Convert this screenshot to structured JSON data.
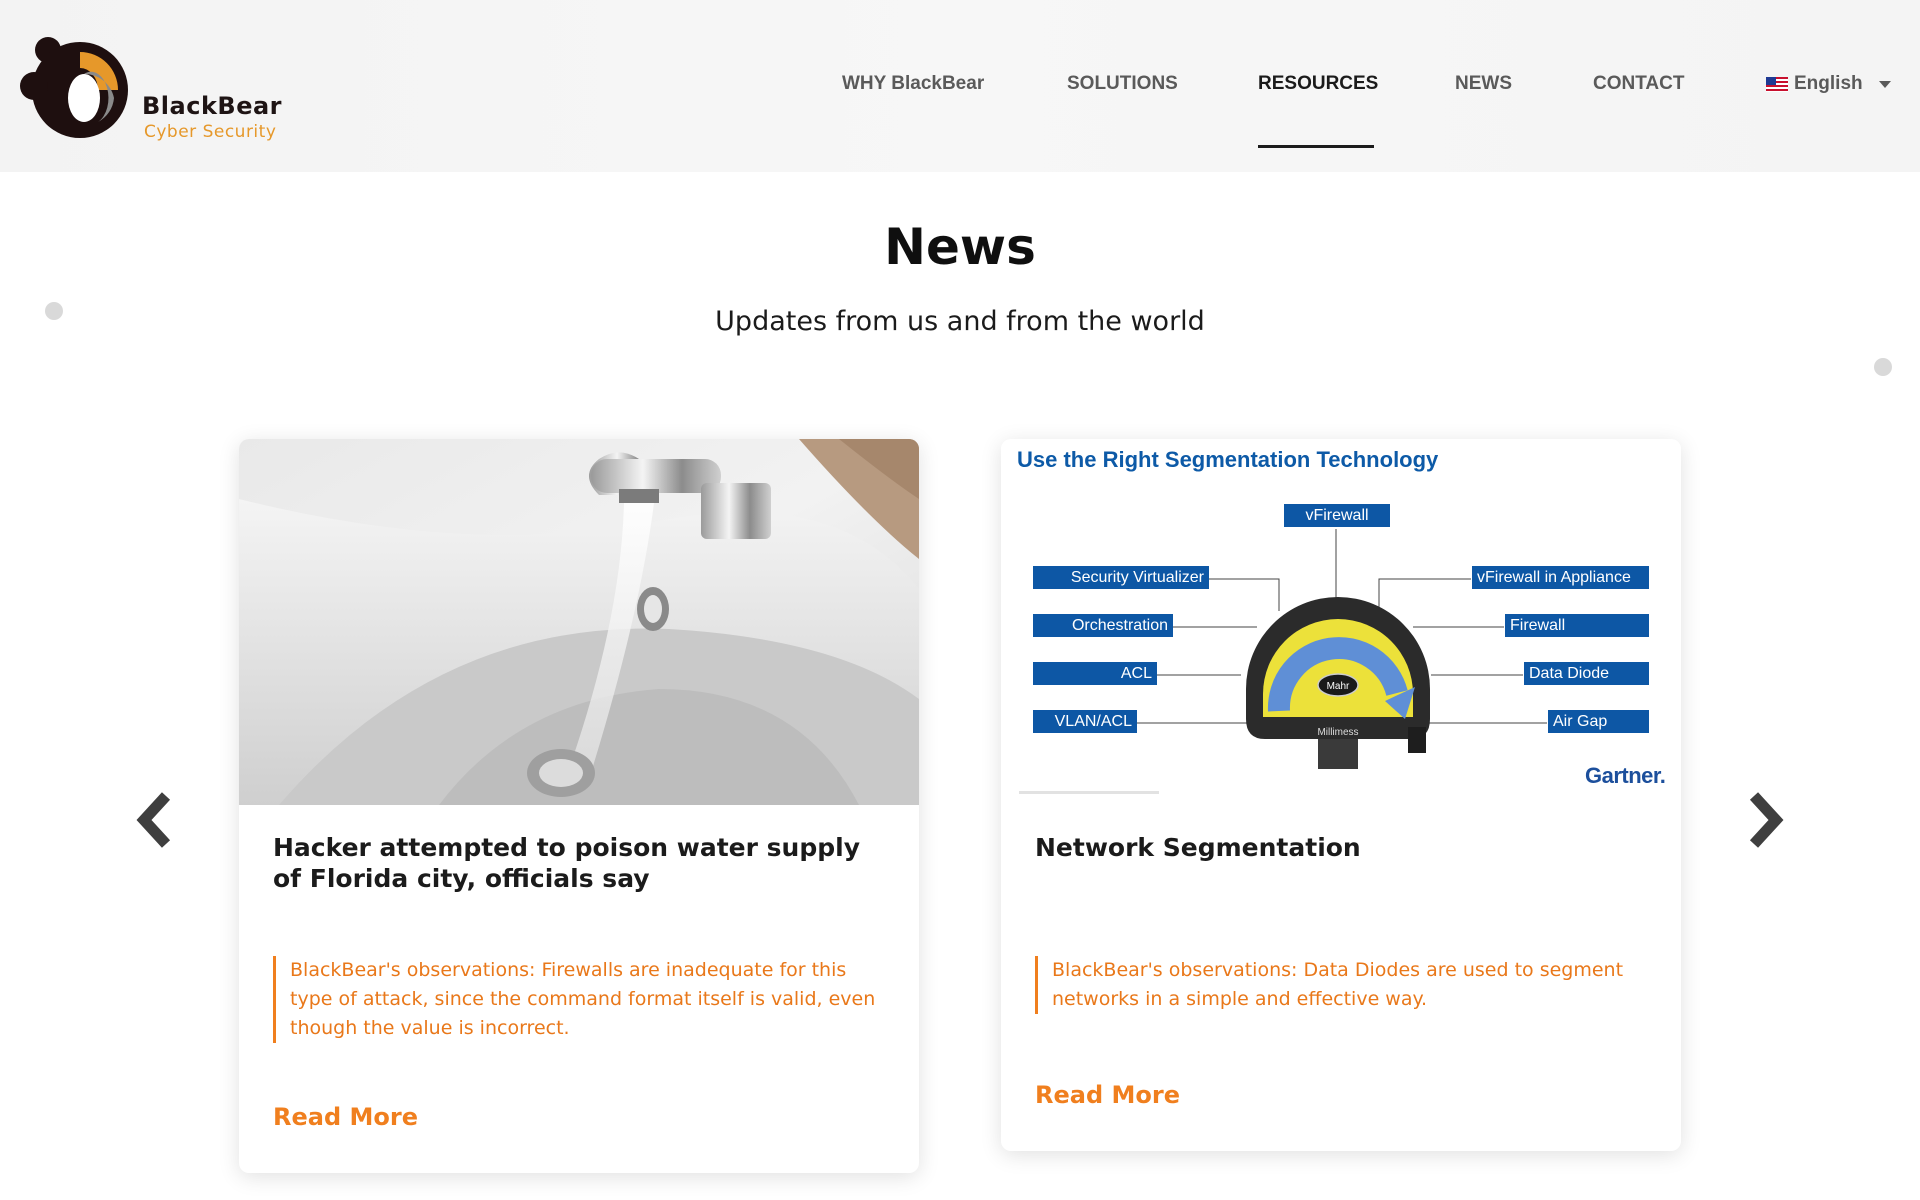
{
  "logo": {
    "brand": "BlackBear",
    "tagline": "Cyber Security"
  },
  "nav": {
    "items": [
      {
        "label": "WHY BlackBear"
      },
      {
        "label": "SOLUTIONS"
      },
      {
        "label": "RESOURCES",
        "active": true
      },
      {
        "label": "NEWS"
      },
      {
        "label": "CONTACT"
      }
    ],
    "language": "English"
  },
  "section": {
    "title": "News",
    "subtitle": "Updates from us and from the world"
  },
  "cards": [
    {
      "title": "Hacker attempted to poison water supply of Florida city, officials say",
      "excerpt": "BlackBear's observations: Firewalls are inadequate for this type of attack, since the command format itself is valid, even though the value is incorrect.",
      "read_more": "Read More"
    },
    {
      "title": "Network Segmentation",
      "excerpt": "BlackBear's observations: Data Diodes are used to segment networks in a simple and effective way.",
      "read_more": "Read More",
      "diagram": {
        "title": "Use the Right Segmentation Technology",
        "top": "vFirewall",
        "left": [
          "Security Virtualizer",
          "Orchestration",
          "ACL",
          "VLAN/ACL"
        ],
        "right": [
          "vFirewall in Appliance",
          "Firewall",
          "Data Diode",
          "Air Gap"
        ],
        "gauge_brand": "Mahr",
        "gauge_label": "Millimess",
        "source": "Gartner."
      }
    }
  ],
  "colors": {
    "accent": "#f07f1e",
    "diagram_blue": "#0d57a5",
    "logo_orange": "#e6982a"
  }
}
